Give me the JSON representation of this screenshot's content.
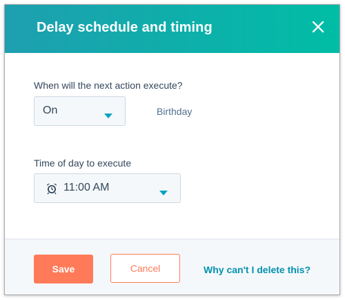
{
  "dialog": {
    "title": "Delay schedule and timing",
    "close_icon": "close-icon"
  },
  "execute_when": {
    "label": "When will the next action execute?",
    "selected": "On",
    "property": "Birthday"
  },
  "time_of_day": {
    "label": "Time of day to execute",
    "selected": "11:00 AM",
    "icon": "alarm-clock-icon"
  },
  "footer": {
    "save_label": "Save",
    "cancel_label": "Cancel",
    "help_link": "Why can't I delete this?"
  },
  "colors": {
    "header_gradient_start": "#1e9fb0",
    "header_gradient_end": "#00bda5",
    "primary": "#ff7a59",
    "link": "#0091ae",
    "caret": "#00a4bd"
  }
}
